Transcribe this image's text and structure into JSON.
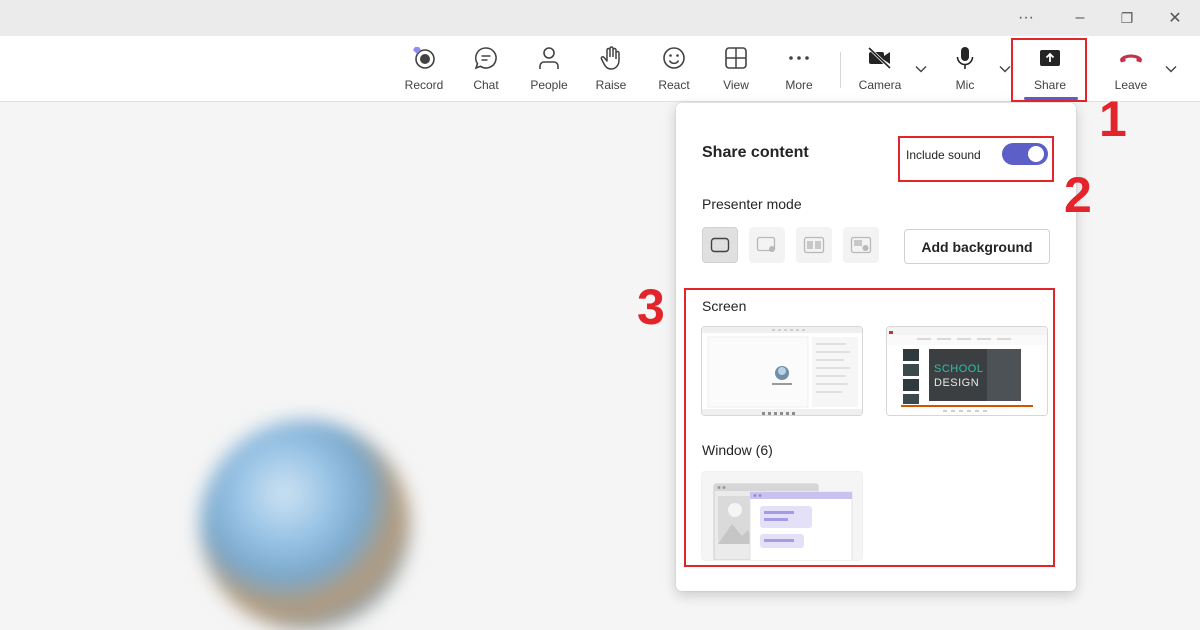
{
  "window_controls": {
    "more": "···",
    "minimize": "–",
    "restore": "❐",
    "close": "✕"
  },
  "toolbar": {
    "record": "Record",
    "chat": "Chat",
    "people": "People",
    "raise": "Raise",
    "react": "React",
    "view": "View",
    "more": "More",
    "camera": "Camera",
    "mic": "Mic",
    "share": "Share",
    "leave": "Leave"
  },
  "share_panel": {
    "title": "Share content",
    "include_sound_label": "Include sound",
    "include_sound_on": true,
    "presenter_mode_title": "Presenter mode",
    "add_background_label": "Add background",
    "screen_section_title": "Screen",
    "window_section_title": "Window (6)",
    "screen2_text_line1": "SCHOOL",
    "screen2_text_line2": "DESIGN"
  },
  "annotations": {
    "n1": "1",
    "n2": "2",
    "n3": "3"
  },
  "colors": {
    "accent": "#5b5fc7",
    "leave_red": "#c4314b",
    "annotation_red": "#e3242b"
  }
}
